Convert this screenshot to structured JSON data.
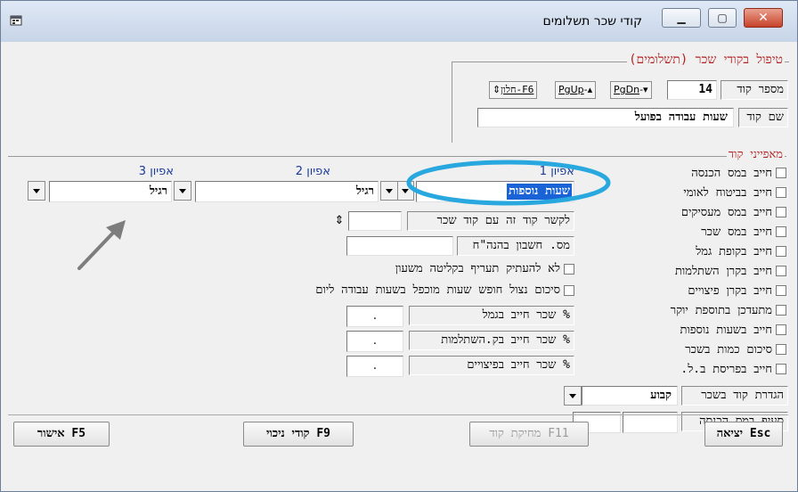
{
  "window": {
    "title": "קודי שכר תשלומים",
    "app_icon": "app-window-icon",
    "controls": {
      "minimize": "▁",
      "maximize": "▢",
      "close": "✕"
    }
  },
  "header": {
    "section_title": "טיפול בקודי שכר (תשלומים)",
    "code_number_label": "מספר קוד",
    "code_number_value": "14",
    "nav": {
      "pgdn": "PgDn",
      "pgup": "PgUp",
      "window_label": "חלון-F6"
    },
    "code_name_label": "שם קוד",
    "code_name_value": "שעות עבודה בפועל"
  },
  "characteristics": {
    "title": "מאפייני קוד",
    "options": [
      "חייב במס הכנסה",
      "חייב בביטוח לאומי",
      "חייב במס מעסיקים",
      "חייב במס שכר",
      "חייב בקופת גמל",
      "חייב בקרן השתלמות",
      "חייב בקרן פיצויים",
      "מתעדכן בתוספת יוקר",
      "חייב בשעות נוספות",
      "סיכום כמות בשכר",
      "חייב בפריסת ב.ל."
    ],
    "definition_label": "הגדרת קוד בשכר",
    "definition_value": "קבוע",
    "tax_section_label": "סעיף במס הכנסה"
  },
  "attributes": {
    "attr1": {
      "label": "אפיון 1",
      "value": "שעות נוספות"
    },
    "attr2": {
      "label": "אפיון 2",
      "value": "רגיל"
    },
    "attr3": {
      "label": "אפיון 3",
      "value": "רגיל"
    }
  },
  "fields": {
    "link_label": "לקשר קוד זה עם קוד שכר",
    "account_label": "מס. חשבון בהנה\"ח",
    "no_copy_label": "לא להעתיק תעריף בקליטה משעון",
    "vacation_label": "סיכום נצול חופש שעות מוכפל בשעות עבודה ליום",
    "pct_rows": [
      {
        "label": "% שכר חייב בגמל",
        "value": "."
      },
      {
        "label": "% שכר חייב בק.השתלמות",
        "value": "."
      },
      {
        "label": "% שכר חייב בפיצויים",
        "value": "."
      }
    ]
  },
  "buttons": {
    "exit": "יציאה Esc",
    "delete": "מחיקת קוד F11",
    "deduction_codes": "קודי ניכוי F9",
    "confirm": "אישור F5"
  },
  "colors": {
    "highlight": "#1a63d6",
    "annotation": "#29a8df",
    "accent_red": "#b22222",
    "arrow": "#7d7d7d"
  }
}
